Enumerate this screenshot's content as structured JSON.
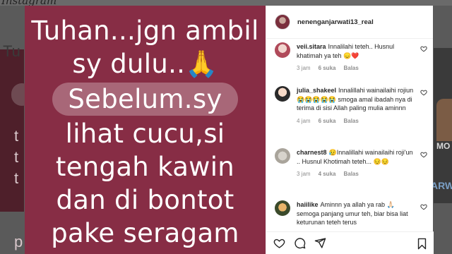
{
  "background": {
    "logo_text": "Instagram",
    "left_text": "Tu",
    "left_words": [
      "t",
      "t",
      "t",
      "p"
    ],
    "right_label": "MO",
    "right_label2": "ARW"
  },
  "post": {
    "lines": [
      "Tuhan...jgn ambil",
      "sy dulu..🙏",
      "Sebelum.sy",
      "lihat cucu,si",
      "tengah kawin",
      "dan di bontot",
      "pake seragam"
    ]
  },
  "panel": {
    "author": "nenenganjarwati13_real",
    "comments": [
      {
        "user": "veii.sitara",
        "text": "Innalilahi teteh.. Husnul khatimah ya teh 😞❤️",
        "time": "3 jam",
        "likes": "6 suka",
        "reply": "Balas"
      },
      {
        "user": "julia_shakeel",
        "text": "Innalillahi wainailaihi rojiun 😭😭😭😭😭 smoga amal ibadah nya di terima di sisi Allah paling mulia aminnn",
        "time": "4 jam",
        "likes": "6 suka",
        "reply": "Balas"
      },
      {
        "user": "charnest8",
        "text": "😥Innalillahi wainailaihi roji'un .. Husnul Khotimah teteh... 😔😔",
        "time": "3 jam",
        "likes": "4 suka",
        "reply": "Balas"
      },
      {
        "user": "haiilike",
        "text": "Aminnn ya allah ya rab 🙏🏻 semoga panjang umur teh, biar bisa liat keturunan teteh terus",
        "time": "",
        "likes": "",
        "reply": ""
      }
    ]
  },
  "icons": [
    "heart-icon",
    "comment-icon",
    "share-icon",
    "bookmark-icon"
  ],
  "colors": {
    "post_background": "#872d45",
    "panel_background": "#ffffff",
    "meta_text": "#8e8e8e"
  }
}
